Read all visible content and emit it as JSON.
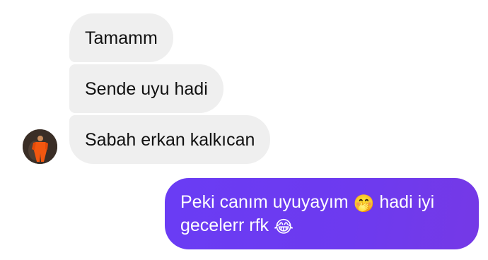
{
  "messages_incoming": [
    {
      "text": "Tamamm"
    },
    {
      "text": "Sende uyu hadi"
    },
    {
      "text": "Sabah erkan kalkıcan"
    }
  ],
  "message_outgoing": {
    "part1": "Peki canım uyuyayım ",
    "emoji1": "🤭",
    "part2": " hadi iyi gecelerr rfk ",
    "emoji2": "😂"
  },
  "colors": {
    "incoming_bubble": "#efefef",
    "outgoing_bubble": "#6b3cf2"
  },
  "icons": {
    "avatar": "contact-avatar"
  }
}
